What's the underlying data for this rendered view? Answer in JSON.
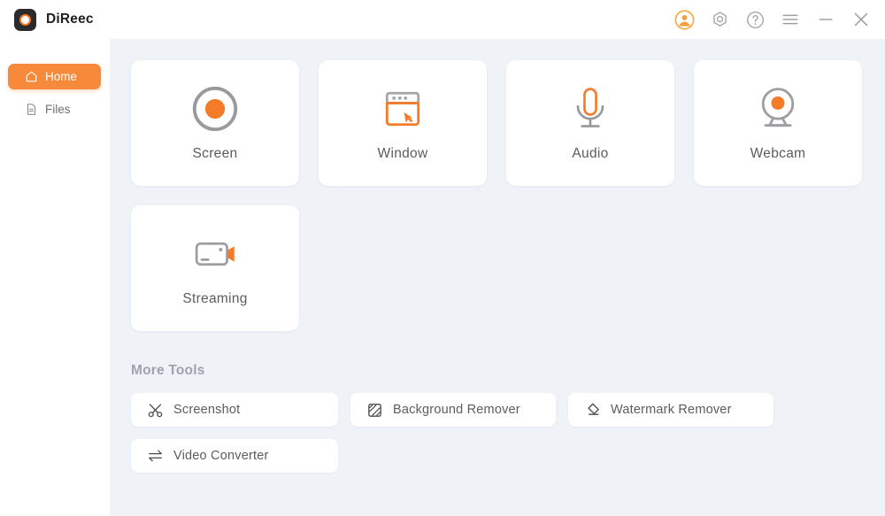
{
  "app": {
    "name": "DiReec",
    "logo_icon": "record-ring-logo",
    "accent_color": "#f47b28",
    "main_bg": "#eff2f7"
  },
  "titlebar": {
    "controls": [
      {
        "name": "account-avatar-icon",
        "label": "Account",
        "icon": "user-avatar-icon"
      },
      {
        "name": "settings-icon",
        "label": "Settings",
        "icon": "hex-nut-settings-icon"
      },
      {
        "name": "help-icon",
        "label": "Help",
        "icon": "question-circle-icon"
      },
      {
        "name": "menu-icon",
        "label": "Menu",
        "icon": "hamburger-menu-icon"
      },
      {
        "name": "minimize-button",
        "label": "Minimize",
        "icon": "minimize-icon"
      },
      {
        "name": "close-button",
        "label": "Close",
        "icon": "close-x-icon"
      }
    ]
  },
  "sidebar": {
    "items": [
      {
        "label": "Home",
        "icon": "home-icon",
        "active": true
      },
      {
        "label": "Files",
        "icon": "file-document-icon",
        "active": false
      }
    ]
  },
  "main": {
    "cards": [
      {
        "label": "Screen",
        "icon": "record-circle-icon"
      },
      {
        "label": "Window",
        "icon": "window-cursor-icon"
      },
      {
        "label": "Audio",
        "icon": "microphone-icon"
      },
      {
        "label": "Webcam",
        "icon": "webcam-icon"
      },
      {
        "label": "Streaming",
        "icon": "video-camera-icon"
      }
    ],
    "more_tools": {
      "title": "More Tools",
      "items": [
        {
          "label": "Screenshot",
          "icon": "scissors-icon"
        },
        {
          "label": "Background Remover",
          "icon": "hatched-square-icon"
        },
        {
          "label": "Watermark Remover",
          "icon": "eraser-icon"
        },
        {
          "label": "Video Converter",
          "icon": "convert-arrows-icon"
        }
      ]
    }
  }
}
